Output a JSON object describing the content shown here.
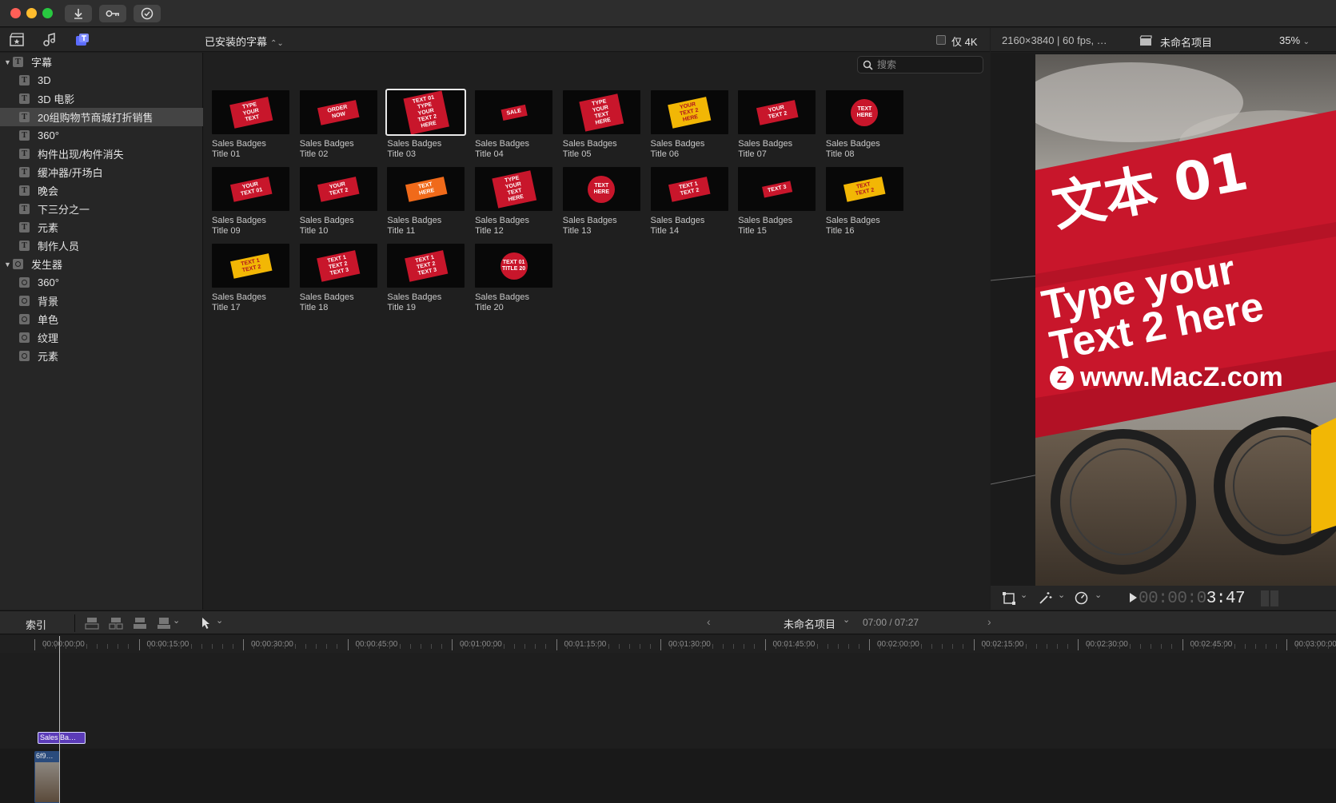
{
  "browser": {
    "library_title": "已安装的字幕",
    "only_4k_label": "仅 4K",
    "search_placeholder": "搜索"
  },
  "sidebar": {
    "sections": [
      {
        "label": "字幕",
        "items": [
          {
            "label": "3D"
          },
          {
            "label": "3D 电影"
          },
          {
            "label": "20组购物节商城打折销售"
          },
          {
            "label": "360°"
          },
          {
            "label": "构件出现/构件消失"
          },
          {
            "label": "缓冲器/开场白"
          },
          {
            "label": "晚会"
          },
          {
            "label": "下三分之一"
          },
          {
            "label": "元素"
          },
          {
            "label": "制作人员"
          }
        ]
      },
      {
        "label": "发生器",
        "items": [
          {
            "label": "360°"
          },
          {
            "label": "背景"
          },
          {
            "label": "单色"
          },
          {
            "label": "纹理"
          },
          {
            "label": "元素"
          }
        ]
      }
    ],
    "selected_item": "20组购物节商城打折销售"
  },
  "grid": {
    "items": [
      {
        "name": "Sales Badges\nTitle 01",
        "thumb": "TYPE YOUR TEXT"
      },
      {
        "name": "Sales Badges\nTitle 02",
        "thumb": "ORDER NOW"
      },
      {
        "name": "Sales Badges\nTitle 03",
        "thumb": "TEXT 01 TYPE YOUR TEXT 2 HERE"
      },
      {
        "name": "Sales Badges\nTitle 04",
        "thumb": "SALE"
      },
      {
        "name": "Sales Badges\nTitle 05",
        "thumb": "TYPE YOUR TEXT HERE"
      },
      {
        "name": "Sales Badges\nTitle 06",
        "thumb": "YOUR TEXT 2 HERE"
      },
      {
        "name": "Sales Badges\nTitle 07",
        "thumb": "YOUR TEXT 2"
      },
      {
        "name": "Sales Badges\nTitle 08",
        "thumb": "TEXT HERE"
      },
      {
        "name": "Sales Badges\nTitle 09",
        "thumb": "YOUR TEXT 01"
      },
      {
        "name": "Sales Badges\nTitle 10",
        "thumb": "YOUR TEXT 2"
      },
      {
        "name": "Sales Badges\nTitle 11",
        "thumb": "TEXT HERE"
      },
      {
        "name": "Sales Badges\nTitle 12",
        "thumb": "TYPE YOUR TEXT HERE"
      },
      {
        "name": "Sales Badges\nTitle 13",
        "thumb": "TEXT HERE"
      },
      {
        "name": "Sales Badges\nTitle 14",
        "thumb": "TEXT 1 TEXT 2"
      },
      {
        "name": "Sales Badges\nTitle 15",
        "thumb": "TEXT 3"
      },
      {
        "name": "Sales Badges\nTitle 16",
        "thumb": "TEXT TEXT 2"
      },
      {
        "name": "Sales Badges\nTitle 17",
        "thumb": "TEXT 1 TEXT 2"
      },
      {
        "name": "Sales Badges\nTitle 18",
        "thumb": "TEXT 1 TEXT 2 TEXT 3"
      },
      {
        "name": "Sales Badges\nTitle 19",
        "thumb": "TEXT 1 TEXT 2 TEXT 3"
      },
      {
        "name": "Sales Badges\nTitle 20",
        "thumb": "TEXT 01 TITLE 20"
      }
    ],
    "selected_index": 2
  },
  "viewer": {
    "resolution": "2160×3840 | 60 fps, …",
    "project_name": "未命名项目",
    "zoom": "35%",
    "preview_line1": "文本 01",
    "preview_line2": "Type your\nText 2 here",
    "watermark": "www.MacZ.com",
    "timecode_dim": "00:00:0",
    "timecode_lit": "3:47"
  },
  "timeline": {
    "index_label": "索引",
    "project_name": "未命名项目",
    "duration": "07:00 / 07:27",
    "ruler": [
      "00:00:00:00",
      "00:00:15:00",
      "00:00:30:00",
      "00:00:45:00",
      "00:01:00:00",
      "00:01:15:00",
      "00:01:30:00",
      "00:01:45:00",
      "00:02:00:00",
      "00:02:15:00",
      "00:02:30:00",
      "00:02:45:00",
      "00:03:00:00"
    ],
    "title_clip_label": "Sales Ba…",
    "video_clip_label": "6f9…"
  },
  "colors": {
    "accent_badge": "#c8162b",
    "badge_yellow": "#f2b705",
    "clip_title": "#5b3bb8",
    "clip_video": "#2a4b7c"
  }
}
